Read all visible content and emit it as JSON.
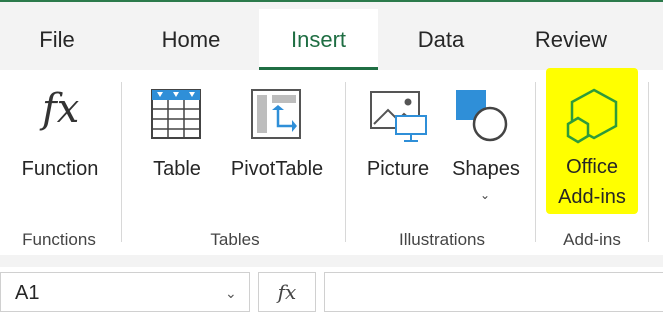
{
  "tabs": [
    {
      "label": "File",
      "active": false
    },
    {
      "label": "Home",
      "active": false
    },
    {
      "label": "Insert",
      "active": true
    },
    {
      "label": "Data",
      "active": false
    },
    {
      "label": "Review",
      "active": false
    }
  ],
  "ribbon": {
    "functions": {
      "button_label": "Function",
      "icon": "fx-icon",
      "group_label": "Functions"
    },
    "tables": {
      "buttons": [
        {
          "label": "Table",
          "icon": "table-icon"
        },
        {
          "label": "PivotTable",
          "icon": "pivottable-icon"
        }
      ],
      "group_label": "Tables"
    },
    "illustrations": {
      "buttons": [
        {
          "label": "Picture",
          "icon": "picture-icon"
        },
        {
          "label": "Shapes",
          "icon": "shapes-icon",
          "has_dropdown": true
        }
      ],
      "group_label": "Illustrations"
    },
    "addins": {
      "button_label_line1": "Office",
      "button_label_line2": "Add-ins",
      "icon": "hexagon-icon",
      "group_label": "Add-ins",
      "highlight_color": "#ffff00"
    }
  },
  "formula_bar": {
    "name_box_value": "A1",
    "fx_label": "fx",
    "formula_value": ""
  },
  "colors": {
    "accent": "#1f6e43",
    "ribbon_bg": "#ffffff",
    "tabbar_bg": "#f3f3f3",
    "icon_blue": "#2f8fd8",
    "addin_green": "#2e9b3a"
  }
}
